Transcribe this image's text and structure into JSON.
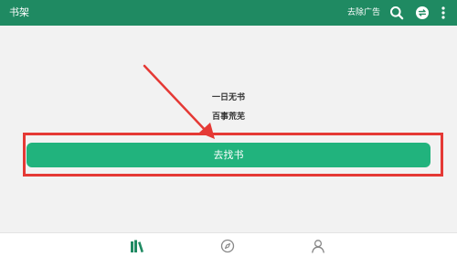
{
  "header": {
    "title": "书架",
    "remove_ads_label": "去除广告",
    "icons": [
      "search-icon",
      "sync-icon",
      "more-icon"
    ]
  },
  "empty_state": {
    "line1": "一日无书",
    "line2": "百事荒芜"
  },
  "main": {
    "find_book_label": "去找书"
  },
  "bottom_nav": {
    "items": [
      {
        "name": "bookshelf",
        "icon": "books-icon",
        "active": true
      },
      {
        "name": "discover",
        "icon": "compass-icon",
        "active": false
      },
      {
        "name": "profile",
        "icon": "user-icon",
        "active": false
      }
    ]
  },
  "colors": {
    "header_bg": "#1f8a62",
    "button_bg": "#21b37d",
    "annotation_red": "#e53935",
    "active_nav": "#1f8a62",
    "inactive_nav": "#888888"
  }
}
